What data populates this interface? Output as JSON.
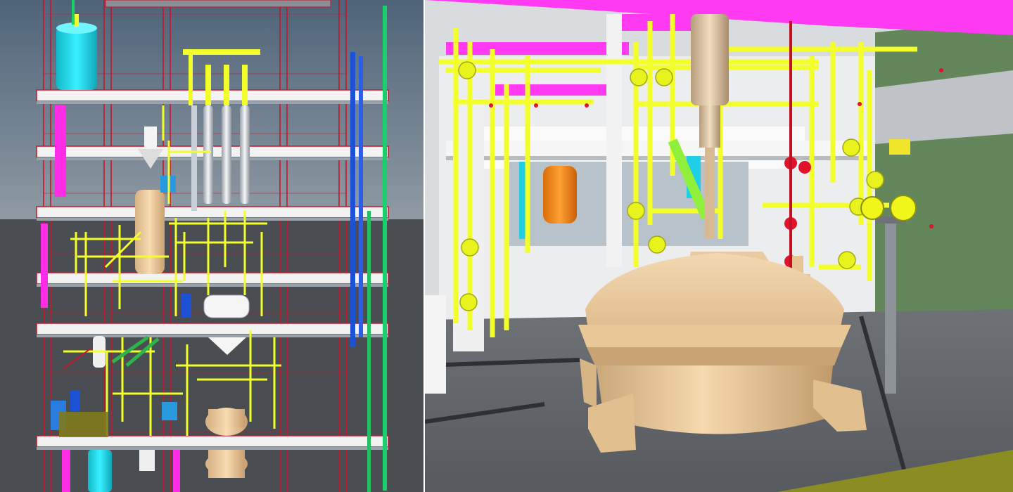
{
  "figure": {
    "panels": [
      {
        "id": "left",
        "description_name": "plant-structure-elevation-view"
      },
      {
        "id": "right",
        "description_name": "reactor-vessel-closeup-view"
      }
    ]
  },
  "colors": {
    "sky": "#5a6f86",
    "ground": "#4a4e52",
    "steel_red": "#c8142a",
    "slab_white": "#f2f2f2",
    "pipe_yellow": "#f2ff2a",
    "pipe_magenta": "#ff2ee6",
    "pipe_green": "#19d16a",
    "pipe_blue": "#1e52d6",
    "tank_cyan": "#1fe1f0",
    "vessel_tan": "#f2d3a6",
    "vessel_orange": "#f48a15",
    "valve_red": "#e0122c",
    "floor_grey": "#6a6e73",
    "wall_green": "#63865b",
    "roof_magenta": "#ff3af2"
  }
}
